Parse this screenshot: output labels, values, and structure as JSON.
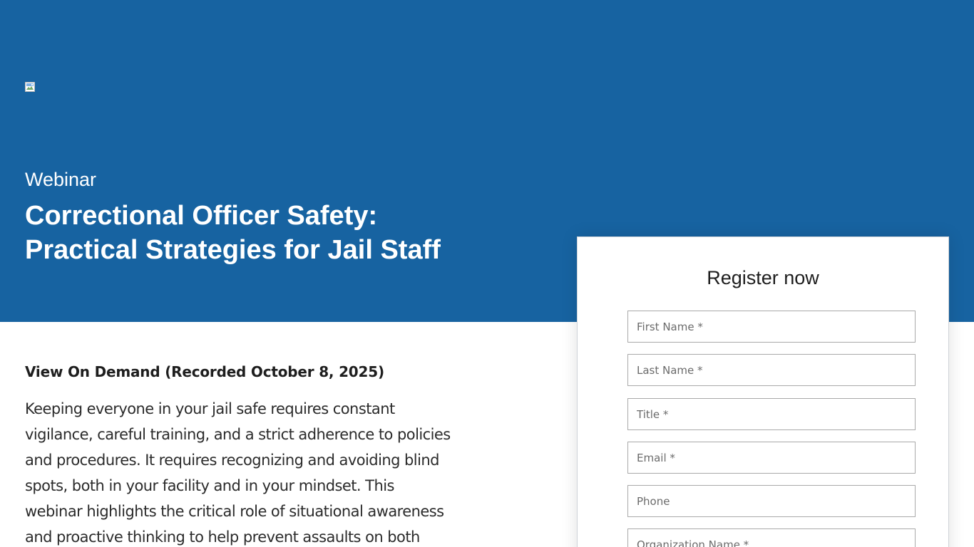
{
  "hero": {
    "logo": "",
    "eyebrow": "Webinar",
    "title_line1": "Correctional Officer Safety:",
    "title_line2": "Practical Strategies for Jail Staff",
    "background_color": "#1763a1"
  },
  "content": {
    "subheading": "View On Demand (Recorded October 8, 2025)",
    "paragraph_lines": [
      "Keeping everyone in your jail safe requires constant",
      "vigilance, careful training, and a strict adherence to policies",
      "and procedures. It requires recognizing and avoiding blind",
      "spots, both in your facility and in your mindset. This",
      "webinar highlights the critical role of situational awareness",
      "and proactive thinking to help prevent assaults on both"
    ]
  },
  "form": {
    "title": "Register now",
    "fields": [
      {
        "placeholder": "First Name *",
        "value": ""
      },
      {
        "placeholder": "Last Name *",
        "value": ""
      },
      {
        "placeholder": "Title *",
        "value": ""
      },
      {
        "placeholder": "Email *",
        "value": ""
      },
      {
        "placeholder": "Phone",
        "value": ""
      },
      {
        "placeholder": "Organization Name *",
        "value": ""
      }
    ]
  }
}
